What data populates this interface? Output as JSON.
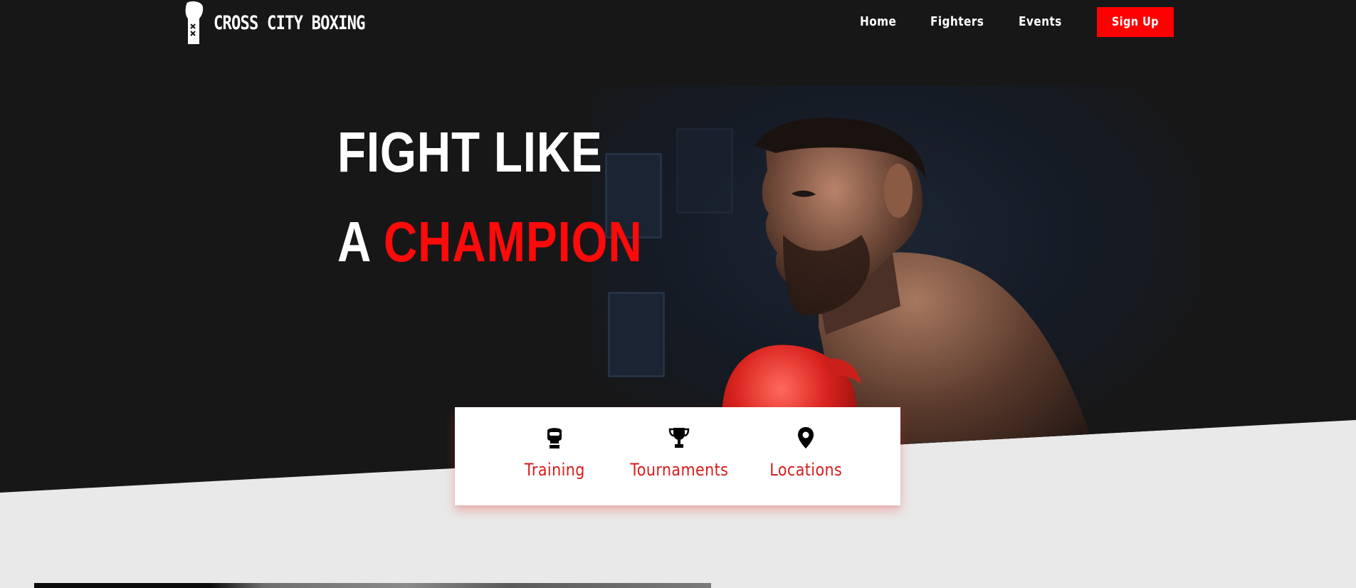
{
  "brand": {
    "name": "CROSS CITY BOXING",
    "icon": "boxing-glove-icon"
  },
  "nav": {
    "items": [
      {
        "label": "Home"
      },
      {
        "label": "Fighters"
      },
      {
        "label": "Events"
      }
    ],
    "cta_label": "Sign Up"
  },
  "hero": {
    "line1": "FIGHT LIKE",
    "line2_prefix": "A",
    "line2_highlight": "CHAMPION",
    "image": "boxer-photo"
  },
  "features": [
    {
      "label": "Training",
      "icon": "boxing-glove-icon"
    },
    {
      "label": "Tournaments",
      "icon": "trophy-icon"
    },
    {
      "label": "Locations",
      "icon": "map-pin-icon"
    }
  ],
  "colors": {
    "accent": "#ff0a0a",
    "feature_text": "#d81b1b",
    "hero_bg": "#171718",
    "page_bg": "#e9e9e9"
  }
}
